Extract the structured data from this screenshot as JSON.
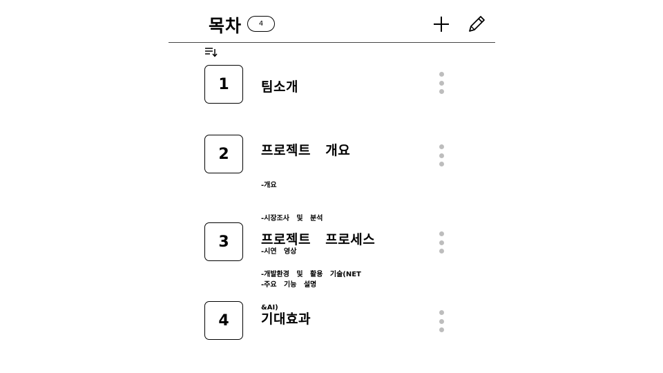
{
  "header": {
    "title": "목차",
    "count": "4"
  },
  "icons": {
    "add": "plus-icon",
    "edit": "pencil-icon",
    "sort": "sort-icon",
    "more": "more-vertical-icon"
  },
  "items": [
    {
      "number": "1",
      "title": "팀소개",
      "details": []
    },
    {
      "number": "2",
      "title": "프로젝트   개요",
      "details": [
        "-개요",
        "-시장조사   및   분석",
        "-시연   영상",
        "-주요   기능   설명"
      ]
    },
    {
      "number": "3",
      "title": "프로젝트   프로세스",
      "details": [
        "-개발환경   및   활용   기술(NET",
        "&AI)"
      ]
    },
    {
      "number": "4",
      "title": "기대효과",
      "details": []
    }
  ],
  "colors": {
    "text": "#000000",
    "kebab_dot": "#bdbdbd",
    "divider": "#444444"
  }
}
